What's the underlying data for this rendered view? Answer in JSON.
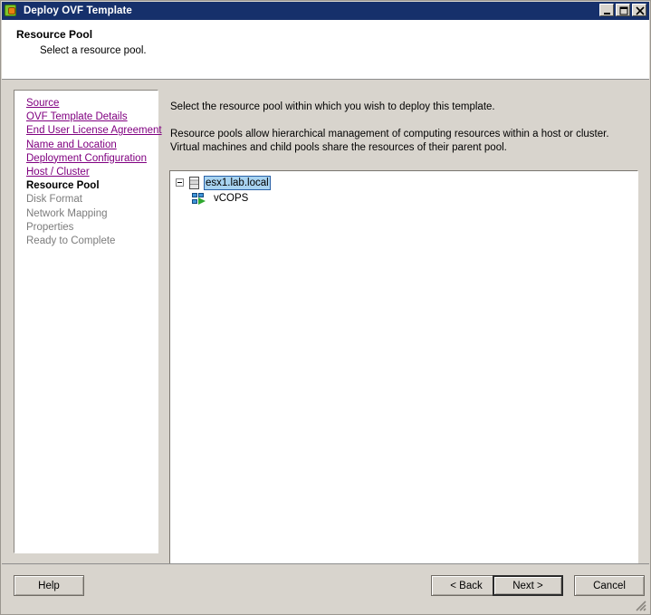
{
  "window": {
    "title": "Deploy OVF Template",
    "app_icon": "ovf-template-icon",
    "controls": {
      "minimize": "minimize-icon",
      "maximize": "maximize-icon",
      "close": "close-icon"
    }
  },
  "header": {
    "title": "Resource Pool",
    "subtitle": "Select a resource pool."
  },
  "steps": [
    {
      "label": "Source",
      "state": "link"
    },
    {
      "label": "OVF Template Details",
      "state": "link"
    },
    {
      "label": "End User License Agreement",
      "state": "link"
    },
    {
      "label": "Name and Location",
      "state": "link"
    },
    {
      "label": "Deployment Configuration",
      "state": "link"
    },
    {
      "label": "Host / Cluster",
      "state": "link"
    },
    {
      "label": "Resource Pool",
      "state": "current"
    },
    {
      "label": "Disk Format",
      "state": "future"
    },
    {
      "label": "Network Mapping",
      "state": "future"
    },
    {
      "label": "Properties",
      "state": "future"
    },
    {
      "label": "Ready to Complete",
      "state": "future"
    }
  ],
  "content": {
    "intro_line_1": "Select the resource pool within which you wish to deploy this template.",
    "intro_line_2": "Resource pools allow hierarchical management of computing resources within a host or cluster. Virtual machines and child pools share the resources of their parent pool."
  },
  "tree": {
    "host": {
      "label": "esx1.lab.local",
      "icon": "host-icon",
      "expander": "collapse-minus-icon",
      "selected": true,
      "expanded": true
    },
    "children": [
      {
        "label": "vCOPS",
        "icon": "resource-pool-icon",
        "selected": false
      }
    ]
  },
  "footer": {
    "help_label": "Help",
    "back_label": "< Back",
    "next_label": "Next >",
    "cancel_label": "Cancel",
    "resize_grip": "resize-grip-icon"
  },
  "colors": {
    "titlebar": "#16306b",
    "dialog_face": "#d8d4cd",
    "link": "#800080",
    "selection": "#a8d3f0",
    "selection_border": "#2a62a8"
  }
}
